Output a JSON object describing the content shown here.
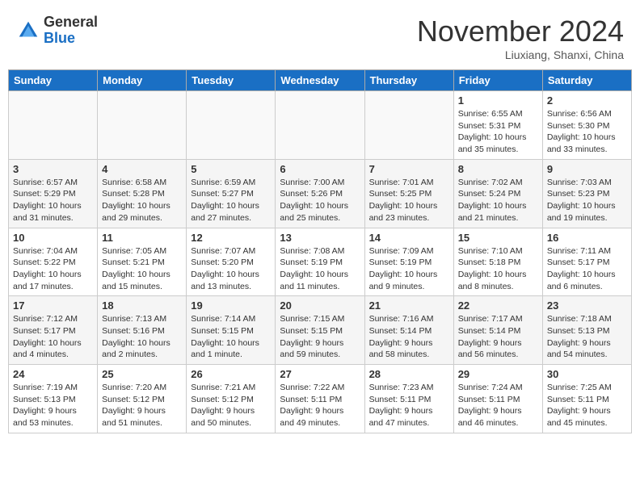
{
  "header": {
    "logo_general": "General",
    "logo_blue": "Blue",
    "month_title": "November 2024",
    "subtitle": "Liuxiang, Shanxi, China"
  },
  "days_of_week": [
    "Sunday",
    "Monday",
    "Tuesday",
    "Wednesday",
    "Thursday",
    "Friday",
    "Saturday"
  ],
  "weeks": [
    [
      {
        "day": "",
        "info": ""
      },
      {
        "day": "",
        "info": ""
      },
      {
        "day": "",
        "info": ""
      },
      {
        "day": "",
        "info": ""
      },
      {
        "day": "",
        "info": ""
      },
      {
        "day": "1",
        "info": "Sunrise: 6:55 AM\nSunset: 5:31 PM\nDaylight: 10 hours\nand 35 minutes."
      },
      {
        "day": "2",
        "info": "Sunrise: 6:56 AM\nSunset: 5:30 PM\nDaylight: 10 hours\nand 33 minutes."
      }
    ],
    [
      {
        "day": "3",
        "info": "Sunrise: 6:57 AM\nSunset: 5:29 PM\nDaylight: 10 hours\nand 31 minutes."
      },
      {
        "day": "4",
        "info": "Sunrise: 6:58 AM\nSunset: 5:28 PM\nDaylight: 10 hours\nand 29 minutes."
      },
      {
        "day": "5",
        "info": "Sunrise: 6:59 AM\nSunset: 5:27 PM\nDaylight: 10 hours\nand 27 minutes."
      },
      {
        "day": "6",
        "info": "Sunrise: 7:00 AM\nSunset: 5:26 PM\nDaylight: 10 hours\nand 25 minutes."
      },
      {
        "day": "7",
        "info": "Sunrise: 7:01 AM\nSunset: 5:25 PM\nDaylight: 10 hours\nand 23 minutes."
      },
      {
        "day": "8",
        "info": "Sunrise: 7:02 AM\nSunset: 5:24 PM\nDaylight: 10 hours\nand 21 minutes."
      },
      {
        "day": "9",
        "info": "Sunrise: 7:03 AM\nSunset: 5:23 PM\nDaylight: 10 hours\nand 19 minutes."
      }
    ],
    [
      {
        "day": "10",
        "info": "Sunrise: 7:04 AM\nSunset: 5:22 PM\nDaylight: 10 hours\nand 17 minutes."
      },
      {
        "day": "11",
        "info": "Sunrise: 7:05 AM\nSunset: 5:21 PM\nDaylight: 10 hours\nand 15 minutes."
      },
      {
        "day": "12",
        "info": "Sunrise: 7:07 AM\nSunset: 5:20 PM\nDaylight: 10 hours\nand 13 minutes."
      },
      {
        "day": "13",
        "info": "Sunrise: 7:08 AM\nSunset: 5:19 PM\nDaylight: 10 hours\nand 11 minutes."
      },
      {
        "day": "14",
        "info": "Sunrise: 7:09 AM\nSunset: 5:19 PM\nDaylight: 10 hours\nand 9 minutes."
      },
      {
        "day": "15",
        "info": "Sunrise: 7:10 AM\nSunset: 5:18 PM\nDaylight: 10 hours\nand 8 minutes."
      },
      {
        "day": "16",
        "info": "Sunrise: 7:11 AM\nSunset: 5:17 PM\nDaylight: 10 hours\nand 6 minutes."
      }
    ],
    [
      {
        "day": "17",
        "info": "Sunrise: 7:12 AM\nSunset: 5:17 PM\nDaylight: 10 hours\nand 4 minutes."
      },
      {
        "day": "18",
        "info": "Sunrise: 7:13 AM\nSunset: 5:16 PM\nDaylight: 10 hours\nand 2 minutes."
      },
      {
        "day": "19",
        "info": "Sunrise: 7:14 AM\nSunset: 5:15 PM\nDaylight: 10 hours\nand 1 minute."
      },
      {
        "day": "20",
        "info": "Sunrise: 7:15 AM\nSunset: 5:15 PM\nDaylight: 9 hours\nand 59 minutes."
      },
      {
        "day": "21",
        "info": "Sunrise: 7:16 AM\nSunset: 5:14 PM\nDaylight: 9 hours\nand 58 minutes."
      },
      {
        "day": "22",
        "info": "Sunrise: 7:17 AM\nSunset: 5:14 PM\nDaylight: 9 hours\nand 56 minutes."
      },
      {
        "day": "23",
        "info": "Sunrise: 7:18 AM\nSunset: 5:13 PM\nDaylight: 9 hours\nand 54 minutes."
      }
    ],
    [
      {
        "day": "24",
        "info": "Sunrise: 7:19 AM\nSunset: 5:13 PM\nDaylight: 9 hours\nand 53 minutes."
      },
      {
        "day": "25",
        "info": "Sunrise: 7:20 AM\nSunset: 5:12 PM\nDaylight: 9 hours\nand 51 minutes."
      },
      {
        "day": "26",
        "info": "Sunrise: 7:21 AM\nSunset: 5:12 PM\nDaylight: 9 hours\nand 50 minutes."
      },
      {
        "day": "27",
        "info": "Sunrise: 7:22 AM\nSunset: 5:11 PM\nDaylight: 9 hours\nand 49 minutes."
      },
      {
        "day": "28",
        "info": "Sunrise: 7:23 AM\nSunset: 5:11 PM\nDaylight: 9 hours\nand 47 minutes."
      },
      {
        "day": "29",
        "info": "Sunrise: 7:24 AM\nSunset: 5:11 PM\nDaylight: 9 hours\nand 46 minutes."
      },
      {
        "day": "30",
        "info": "Sunrise: 7:25 AM\nSunset: 5:11 PM\nDaylight: 9 hours\nand 45 minutes."
      }
    ]
  ]
}
